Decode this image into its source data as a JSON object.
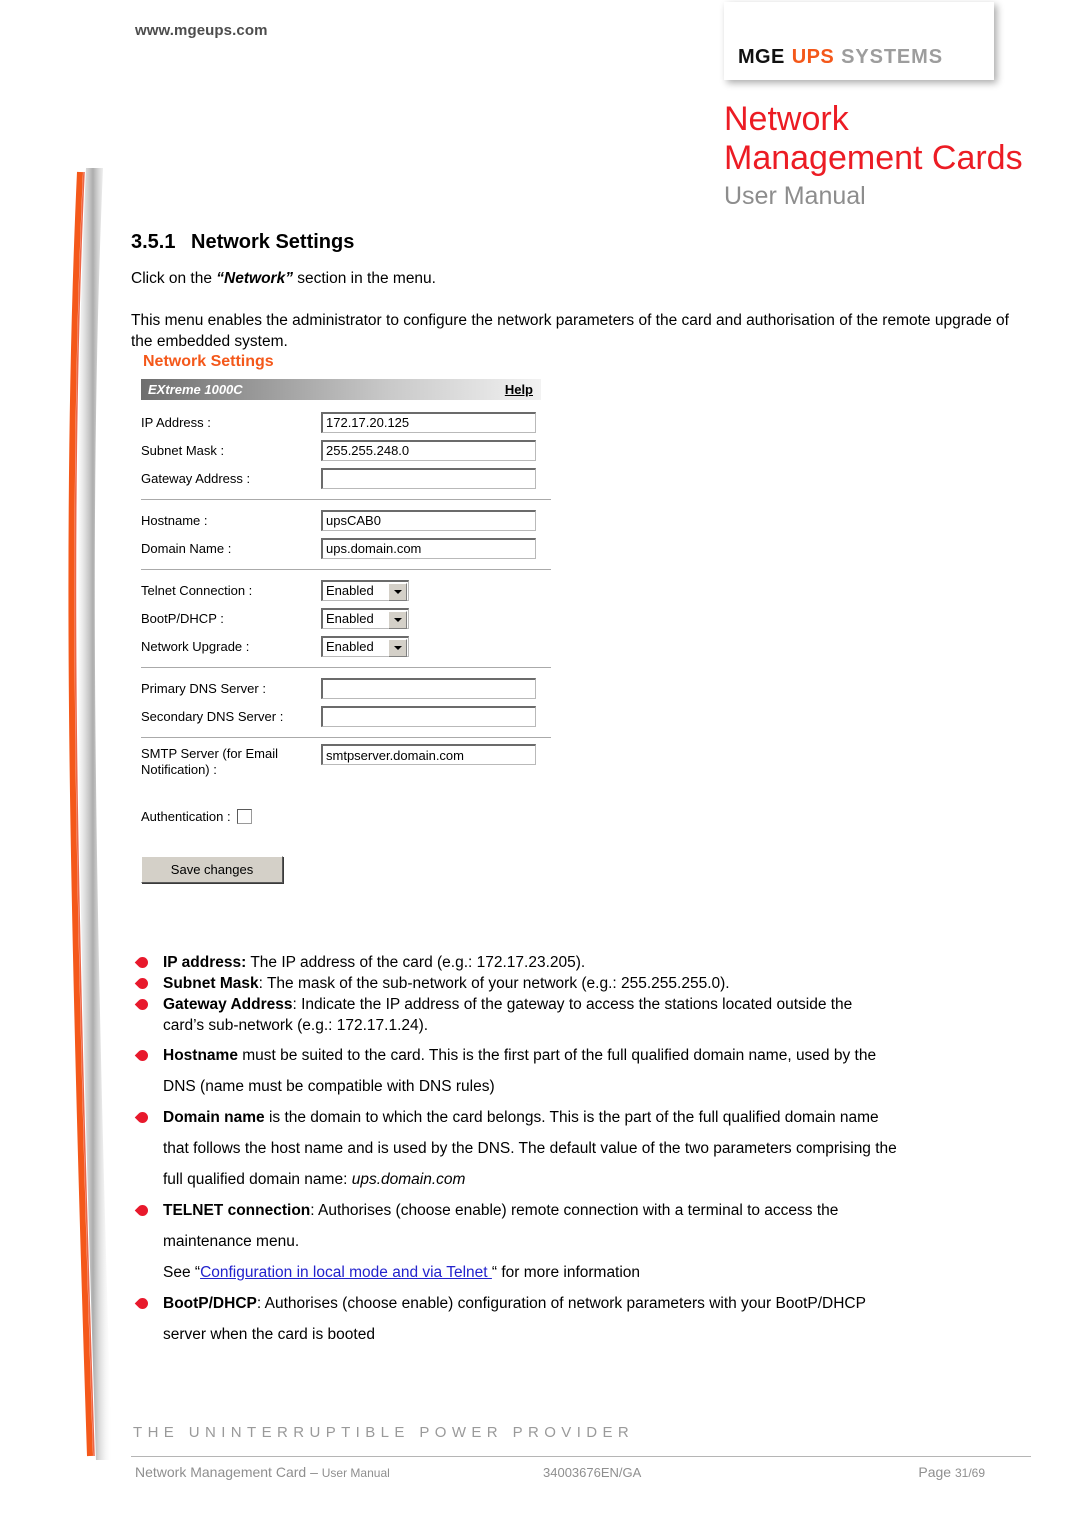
{
  "header": {
    "site_url": "www.mgeups.com",
    "logo": {
      "part1": "MGE",
      "part2": "UPS",
      "part3": "SYSTEMS"
    },
    "title_line1": "Network",
    "title_line2": "Management Cards",
    "subtitle": "User Manual",
    "title_color": "#EC1C24",
    "accent_color": "#F4581A"
  },
  "section": {
    "number": "3.5.1",
    "heading": "Network Settings",
    "intro_pre": "Click on the ",
    "intro_quoted": "“Network”",
    "intro_post": " section in the menu.",
    "description": "This menu enables the administrator to configure the network parameters of the card and authorisation of the remote upgrade of the embedded system."
  },
  "screenshot": {
    "caption": "Network Settings",
    "window_name": "EXtreme 1000C",
    "help_label": "Help",
    "fields": [
      {
        "label": "IP Address :",
        "value": "172.17.20.125"
      },
      {
        "label": "Subnet Mask :",
        "value": "255.255.248.0"
      },
      {
        "label": "Gateway Address :",
        "value": ""
      }
    ],
    "host_fields": [
      {
        "label": "Hostname :",
        "value": "upsCAB0"
      },
      {
        "label": "Domain Name :",
        "value": "ups.domain.com"
      }
    ],
    "selects": [
      {
        "label": "Telnet Connection :",
        "value": "Enabled"
      },
      {
        "label": "BootP/DHCP :",
        "value": "Enabled"
      },
      {
        "label": "Network Upgrade :",
        "value": "Enabled"
      }
    ],
    "dns_fields": [
      {
        "label": "Primary DNS Server :",
        "value": ""
      },
      {
        "label": "Secondary DNS Server :",
        "value": ""
      }
    ],
    "smtp": {
      "label_line1": "SMTP Server (for Email",
      "label_line2": "Notification) :",
      "value": "smtpserver.domain.com"
    },
    "authentication": {
      "label": "Authentication :",
      "checked": false
    },
    "save_button": "Save changes"
  },
  "bullets": {
    "ip": {
      "term": "IP address:",
      "text": " The IP address of the card (e.g.: 172.17.23.205)."
    },
    "subnet": {
      "term": "Subnet Mask",
      "text": ": The mask of the sub-network of your network (e.g.: 255.255.255.0)."
    },
    "gateway": {
      "term": "Gateway Address",
      "text": ": Indicate the IP address of the gateway to access the stations located outside the",
      "text2": "card’s sub-network (e.g.: 172.17.1.24)."
    },
    "hostname": {
      "term": "Hostname",
      "text": " must be suited to the card. This is the first part of the full qualified domain name, used by the",
      "text2": "DNS  (name must be compatible with DNS rules)"
    },
    "domain": {
      "term": "Domain name",
      "text": " is the domain to which the card belongs. This is the part of the full qualified domain name",
      "text2": "that follows the host name and is used by the DNS. The default value of the two parameters comprising the",
      "text3_pre": "full qualified domain name: ",
      "text3_italic": "ups.domain.com"
    },
    "telnet": {
      "term": "TELNET connection",
      "text": ": Authorises (choose enable) remote connection with a terminal to access the",
      "text2": "maintenance menu.",
      "see_pre": "See “",
      "link": "Configuration in local mode and via Telnet ",
      "see_post": "“ for more information"
    },
    "bootp": {
      "term": "BootP/DHCP",
      "text": ": Authorises (choose enable) configuration of network parameters with your BootP/DHCP",
      "text2": "server when the card is booted"
    }
  },
  "footer": {
    "slogan": "THE UNINTERRUPTIBLE POWER PROVIDER",
    "doc_name": "Network Management Card – ",
    "doc_kind": "User Manual",
    "doc_code": "34003676EN/GA",
    "page_label": "Page ",
    "page_value": "31/69"
  }
}
